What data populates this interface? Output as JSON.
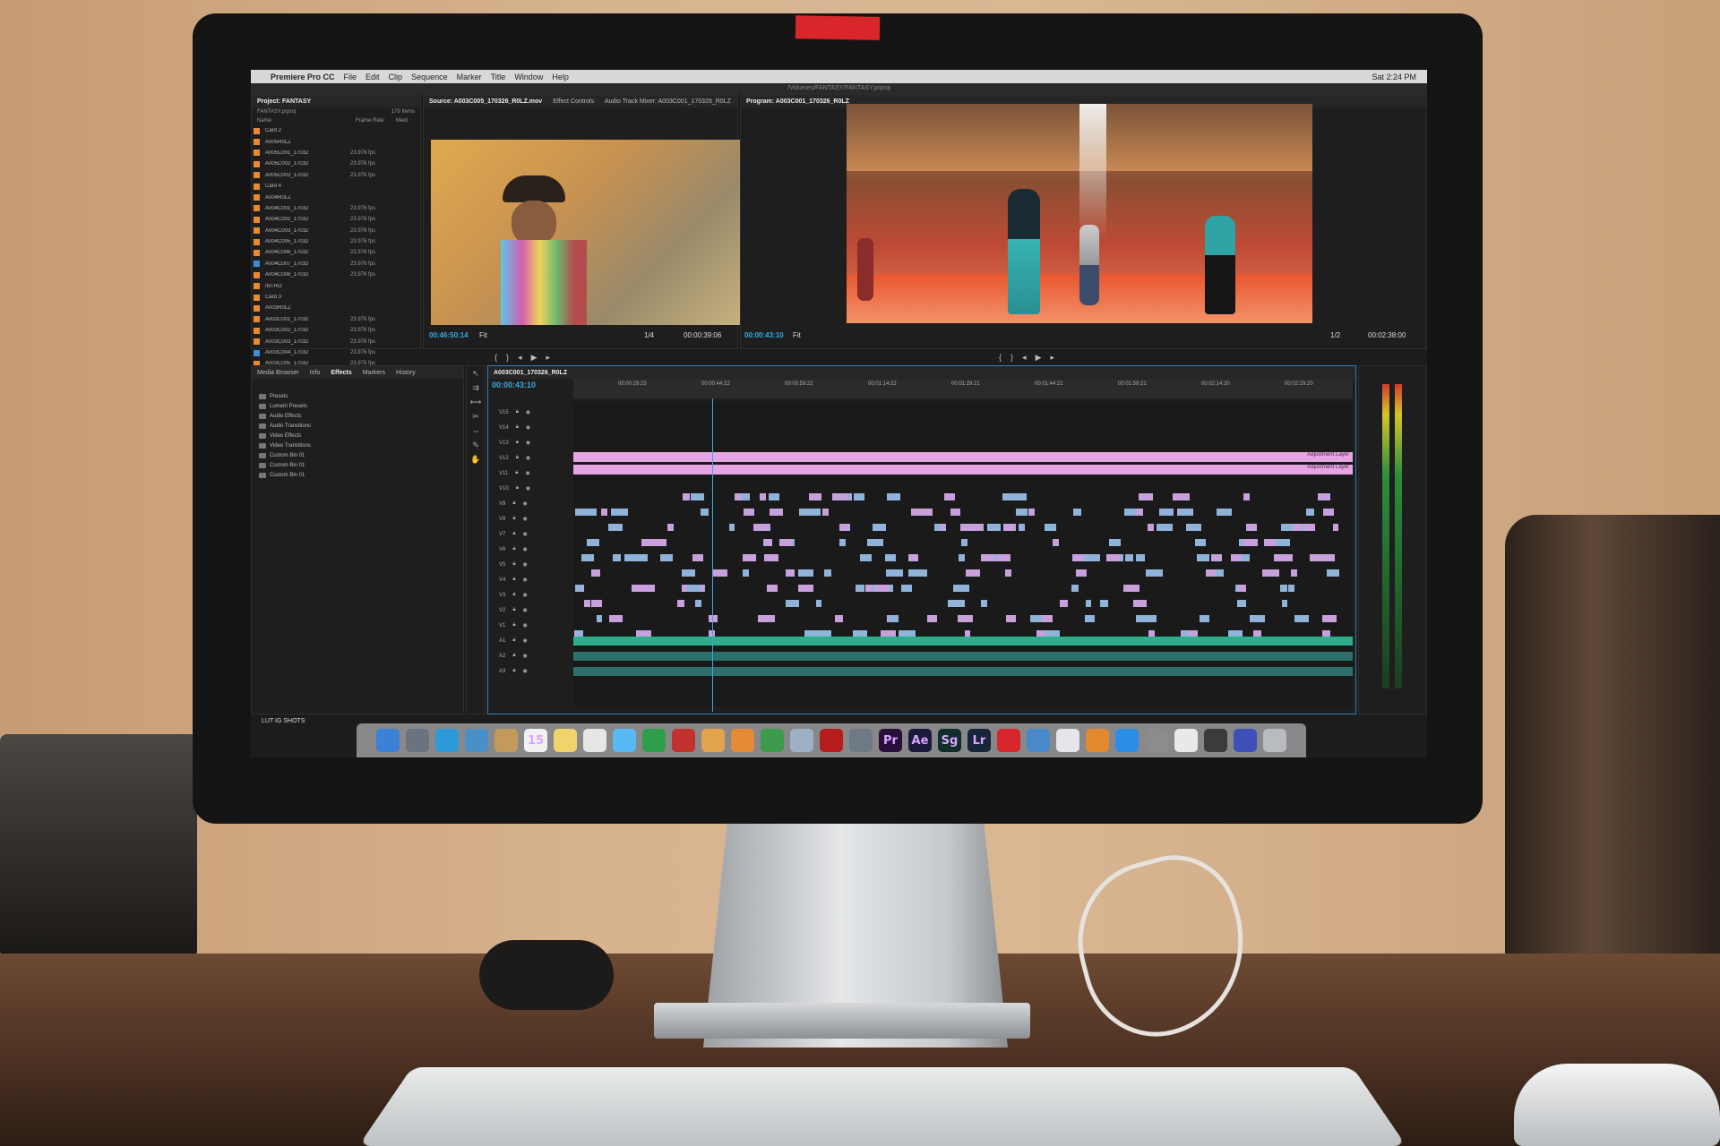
{
  "menubar": {
    "app_name": "Premiere Pro CC",
    "items": [
      "File",
      "Edit",
      "Clip",
      "Sequence",
      "Marker",
      "Title",
      "Window",
      "Help"
    ],
    "clock": "Sat 2:24 PM"
  },
  "window_title": "/Volumes/FANTASY/FANTASY.prproj",
  "project_panel": {
    "tab": "Project: FANTASY",
    "project_file": "FANTASY.prproj",
    "item_count": "179 Items",
    "columns": [
      "Name",
      "Frame Rate",
      "Medi"
    ],
    "rows": [
      {
        "name": "Card 2",
        "fr": "",
        "color": "#e88b2e"
      },
      {
        "name": "A005R0LZ",
        "fr": "",
        "color": "#e88b2e"
      },
      {
        "name": "A005C001_17032",
        "fr": "23.976 fps",
        "color": "#e88b2e"
      },
      {
        "name": "A005C002_17032",
        "fr": "23.976 fps",
        "color": "#e88b2e"
      },
      {
        "name": "A005C003_17032",
        "fr": "23.976 fps",
        "color": "#e88b2e"
      },
      {
        "name": "Card 4",
        "fr": "",
        "color": "#e88b2e"
      },
      {
        "name": "A004R0LZ",
        "fr": "",
        "color": "#e88b2e"
      },
      {
        "name": "A004C001_17032",
        "fr": "23.976 fps",
        "color": "#e88b2e"
      },
      {
        "name": "A004C002_17032",
        "fr": "23.976 fps",
        "color": "#e88b2e"
      },
      {
        "name": "A004C003_17032",
        "fr": "23.976 fps",
        "color": "#e88b2e"
      },
      {
        "name": "A004C005_17032",
        "fr": "23.976 fps",
        "color": "#e88b2e"
      },
      {
        "name": "A004C006_17032",
        "fr": "23.976 fps",
        "color": "#e88b2e"
      },
      {
        "name": "A004C007_17032",
        "fr": "23.976 fps",
        "color": "#3a8fd6"
      },
      {
        "name": "A004C008_17032",
        "fr": "23.976 fps",
        "color": "#e88b2e"
      },
      {
        "name": "INTRO",
        "fr": "",
        "color": "#e88b2e"
      },
      {
        "name": "Card 3",
        "fr": "",
        "color": "#e88b2e"
      },
      {
        "name": "A003R0LZ",
        "fr": "",
        "color": "#e88b2e"
      },
      {
        "name": "A003C001_17032",
        "fr": "23.976 fps",
        "color": "#e88b2e"
      },
      {
        "name": "A003C002_17032",
        "fr": "23.976 fps",
        "color": "#e88b2e"
      },
      {
        "name": "A003C003_17032",
        "fr": "23.976 fps",
        "color": "#e88b2e"
      },
      {
        "name": "A003C004_17032",
        "fr": "23.976 fps",
        "color": "#3a8fd6"
      },
      {
        "name": "A003C005_17032",
        "fr": "23.976 fps",
        "color": "#e88b2e"
      },
      {
        "name": "A003C006_17032",
        "fr": "23.976 fps",
        "color": "#e88b2e"
      }
    ]
  },
  "source_monitor": {
    "tabs": [
      "Source: A003C005_170326_R0LZ.mov",
      "Effect Controls",
      "Audio Track Mixer: A003C001_170326_R0LZ"
    ],
    "timecode": "00:46:50:14",
    "fit": "Fit",
    "fraction": "1/4",
    "duration": "00:00:39:06"
  },
  "program_monitor": {
    "tab": "Program: A003C001_170326_R0LZ",
    "timecode": "00:00:43:10",
    "fit": "Fit",
    "fraction": "1/2",
    "duration": "00:02:38:00"
  },
  "effects_panel": {
    "tabs": [
      "Media Browser",
      "Info",
      "Effects",
      "Markers",
      "History"
    ],
    "items": [
      "Presets",
      "Lumetri Presets",
      "Audio Effects",
      "Audio Transitions",
      "Video Effects",
      "Video Transitions",
      "Custom Bin 01",
      "Custom Bin 01",
      "Custom Bin 01"
    ]
  },
  "timeline": {
    "tab": "A003C001_170326_R0LZ",
    "timecode": "00:00:43:10",
    "ruler": [
      "00:00:29:23",
      "00:00:44:22",
      "00:00:59:22",
      "00:01:14:22",
      "00:01:29:21",
      "00:01:44:21",
      "00:01:59:21",
      "00:02:14:20",
      "00:02:29:20"
    ],
    "tracks": [
      "V15",
      "V14",
      "V13",
      "V12",
      "V11",
      "V10",
      "V9",
      "V8",
      "V7",
      "V6",
      "V5",
      "V4",
      "V3",
      "V2",
      "V1",
      "A1",
      "A2",
      "A3"
    ],
    "adjustment_label": "Adjustment Layer"
  },
  "desktop_label": "LUT IG SHOTS",
  "dock": {
    "apps": [
      {
        "label": "",
        "name": "finder",
        "color": "#3b82d6"
      },
      {
        "label": "",
        "name": "launchpad",
        "color": "#6b7280"
      },
      {
        "label": "",
        "name": "safari",
        "color": "#2a9bd8"
      },
      {
        "label": "",
        "name": "mail",
        "color": "#4a90c8"
      },
      {
        "label": "",
        "name": "contacts",
        "color": "#c49a5a"
      },
      {
        "label": "15",
        "name": "calendar",
        "color": "#f1f1f1"
      },
      {
        "label": "",
        "name": "notes",
        "color": "#f0d36a"
      },
      {
        "label": "",
        "name": "reminders",
        "color": "#e6e6e6"
      },
      {
        "label": "",
        "name": "messages",
        "color": "#58b9f5"
      },
      {
        "label": "",
        "name": "facetime",
        "color": "#2e9e4a"
      },
      {
        "label": "",
        "name": "photo-booth",
        "color": "#c2302f"
      },
      {
        "label": "",
        "name": "photos",
        "color": "#e2a34b"
      },
      {
        "label": "",
        "name": "pages",
        "color": "#e48b33"
      },
      {
        "label": "",
        "name": "numbers",
        "color": "#3c9b4d"
      },
      {
        "label": "",
        "name": "preview",
        "color": "#9db0c4"
      },
      {
        "label": "",
        "name": "record",
        "color": "#b71c1c"
      },
      {
        "label": "",
        "name": "keynote",
        "color": "#6d7a86"
      },
      {
        "label": "Pr",
        "name": "premiere",
        "color": "#2a0f3d"
      },
      {
        "label": "Ae",
        "name": "after-effects",
        "color": "#1a1a3d"
      },
      {
        "label": "Sg",
        "name": "speedgrade",
        "color": "#0f2e2a"
      },
      {
        "label": "Lr",
        "name": "lightroom",
        "color": "#16253a"
      },
      {
        "label": "",
        "name": "creative-cloud",
        "color": "#d6262b"
      },
      {
        "label": "",
        "name": "keynote-2",
        "color": "#4a89c9"
      },
      {
        "label": "",
        "name": "itunes",
        "color": "#e6e6ea"
      },
      {
        "label": "",
        "name": "ibooks",
        "color": "#e2882f"
      },
      {
        "label": "",
        "name": "app-store",
        "color": "#2a8ee6"
      },
      {
        "label": "",
        "name": "system-preferences",
        "color": "#8c8c8c"
      },
      {
        "label": "",
        "name": "textedit",
        "color": "#e9e9e9"
      },
      {
        "label": "",
        "name": "photo-viewer",
        "color": "#3b3b3b"
      },
      {
        "label": "",
        "name": "xcode",
        "color": "#3e4fb8"
      },
      {
        "label": "",
        "name": "trash",
        "color": "#b8bcc0"
      }
    ]
  }
}
